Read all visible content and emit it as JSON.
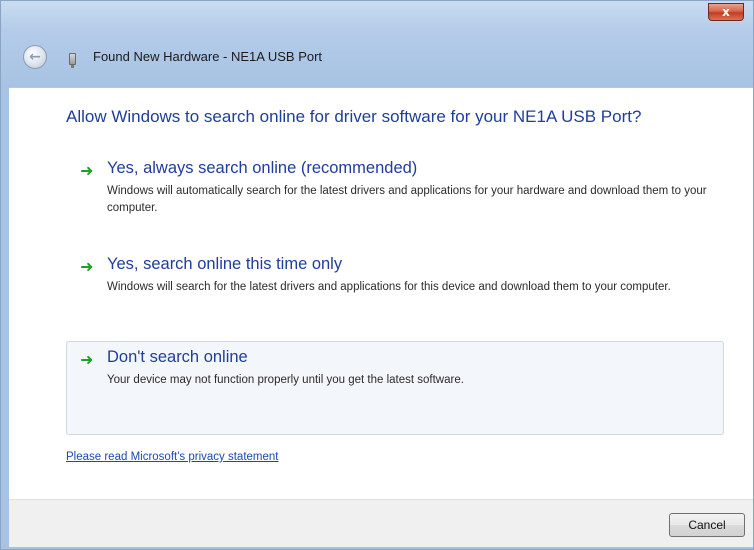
{
  "window": {
    "title": "Found New Hardware - NE1A USB Port",
    "close_glyph": "x"
  },
  "icons": {
    "back": "back-arrow-icon",
    "device": "usb-device-icon",
    "option_arrow": "green-arrow-icon"
  },
  "colors": {
    "heading": "#1f3e9a",
    "arrow": "#1f9f2a",
    "link": "#1b49b4",
    "close": "#c33d24"
  },
  "main": {
    "heading": "Allow Windows to search online for driver software for your NE1A USB Port?",
    "options": [
      {
        "title": "Yes, always search online (recommended)",
        "description": "Windows will automatically search for the latest drivers and applications for your hardware and download them to your computer."
      },
      {
        "title": "Yes, search online this time only",
        "description": "Windows will search for the latest drivers and applications for this device and download them to your computer."
      },
      {
        "title": "Don't search online",
        "description": "Your device may not function properly until you get the latest software."
      }
    ],
    "privacy_link": "Please read Microsoft's  privacy statement"
  },
  "footer": {
    "cancel_label": "Cancel"
  }
}
